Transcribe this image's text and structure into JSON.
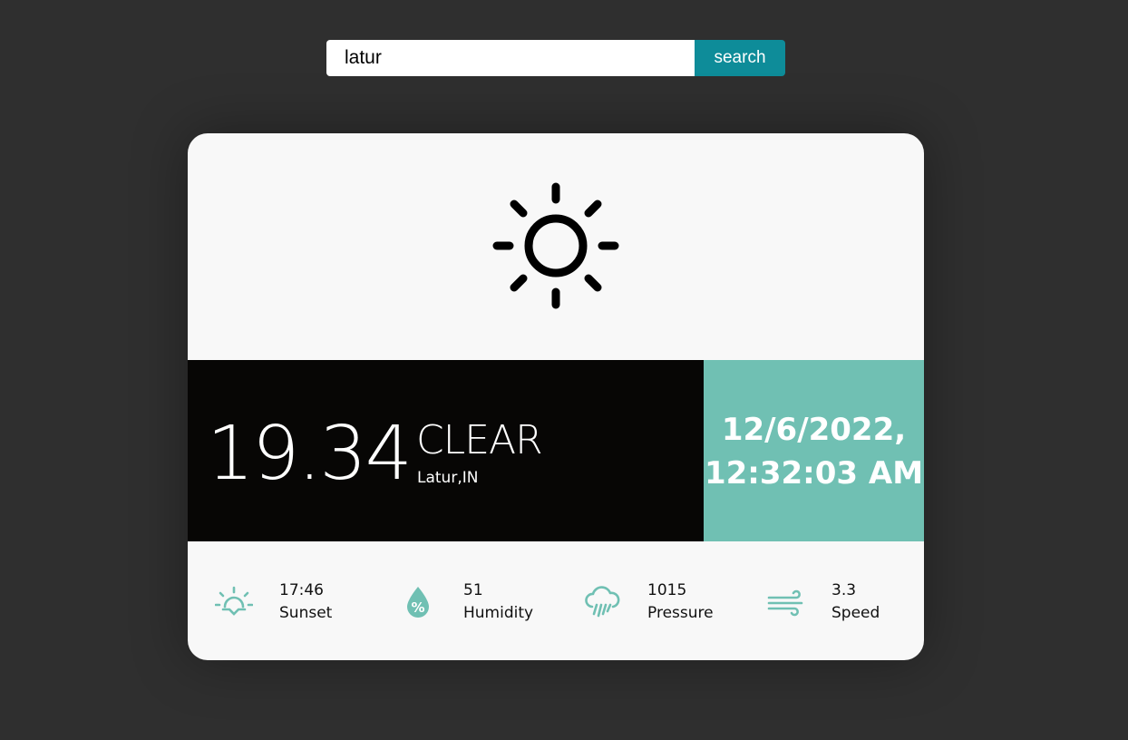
{
  "search": {
    "value": "latur",
    "button_label": "search"
  },
  "weather": {
    "icon": "sun-icon",
    "temperature": "19.34",
    "condition": "CLEAR",
    "location": "Latur,IN",
    "date": "12/6/2022,",
    "time": "12:32:03 AM"
  },
  "stats": [
    {
      "icon": "sunset-icon",
      "value": "17:46",
      "label": "Sunset"
    },
    {
      "icon": "humidity-icon",
      "value": "51",
      "label": "Humidity"
    },
    {
      "icon": "pressure-icon",
      "value": "1015",
      "label": "Pressure"
    },
    {
      "icon": "wind-icon",
      "value": "3.3",
      "label": "Speed"
    }
  ],
  "colors": {
    "background": "#2f2f2f",
    "card": "#f8f8f8",
    "accent": "#70c0b3",
    "button": "#0e8c99",
    "temp_panel": "#070605"
  }
}
